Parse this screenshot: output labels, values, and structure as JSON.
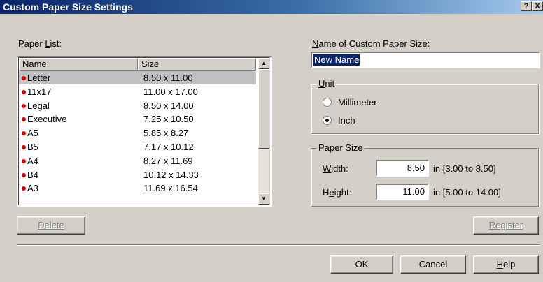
{
  "window": {
    "title": "Custom Paper Size Settings",
    "help_btn": "?",
    "close_btn": "X"
  },
  "paper_list": {
    "label": "Paper List:",
    "columns": [
      "Name",
      "Size"
    ],
    "rows": [
      {
        "name": "Letter",
        "size": "8.50 x 11.00",
        "selected": true
      },
      {
        "name": "11x17",
        "size": "11.00 x 17.00"
      },
      {
        "name": "Legal",
        "size": "8.50 x 14.00"
      },
      {
        "name": "Executive",
        "size": "7.25 x 10.50"
      },
      {
        "name": "A5",
        "size": "5.85 x 8.27"
      },
      {
        "name": "B5",
        "size": "7.17 x 10.12"
      },
      {
        "name": "A4",
        "size": "8.27 x 11.69"
      },
      {
        "name": "B4",
        "size": "10.12 x 14.33"
      },
      {
        "name": "A3",
        "size": "11.69 x 16.54"
      }
    ],
    "scroll_up": "▲",
    "scroll_down": "▼"
  },
  "delete_button": "Delete",
  "name_field": {
    "label": "Name of Custom Paper Size:",
    "value": "New Name"
  },
  "unit": {
    "label": "Unit",
    "options": [
      {
        "label": "Millimeter",
        "checked": false
      },
      {
        "label": "Inch",
        "checked": true
      }
    ]
  },
  "paper_size": {
    "label": "Paper Size",
    "width_label": "Width:",
    "width_value": "8.50",
    "width_range": "in [3.00 to 8.50]",
    "height_label": "Height:",
    "height_value": "11.00",
    "height_range": "in [5.00 to 14.00]"
  },
  "register_button": "Register",
  "ok_button": "OK",
  "cancel_button": "Cancel",
  "help_button": "Help"
}
